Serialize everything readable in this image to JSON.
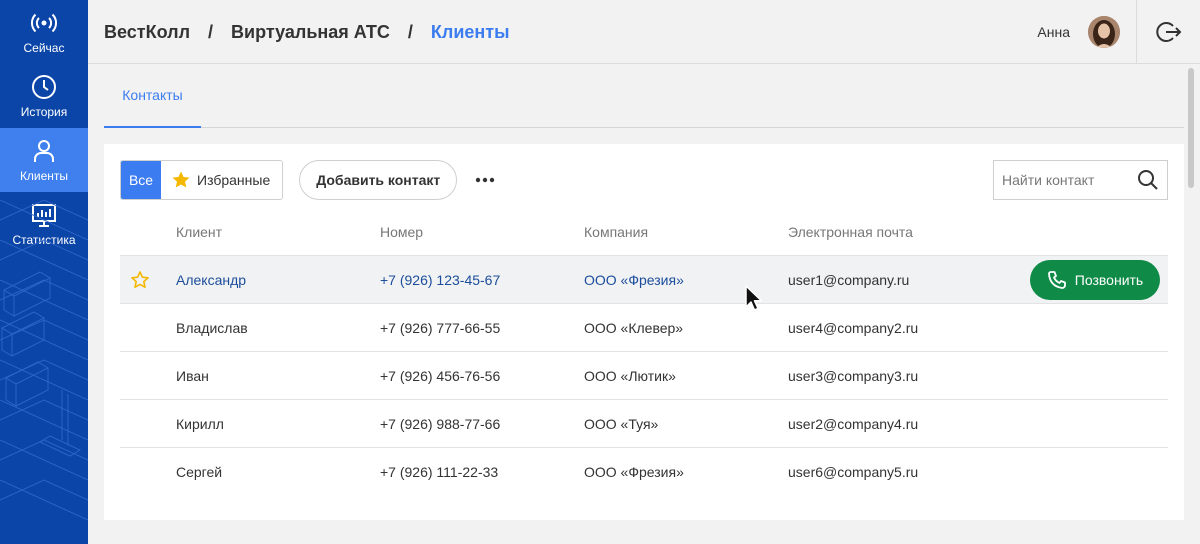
{
  "sidebar": {
    "items": [
      {
        "label": "Сейчас",
        "icon": "broadcast-icon"
      },
      {
        "label": "История",
        "icon": "clock-icon"
      },
      {
        "label": "Клиенты",
        "icon": "person-icon"
      },
      {
        "label": "Статистика",
        "icon": "chart-icon"
      }
    ],
    "active": "Клиенты"
  },
  "header": {
    "breadcrumb": [
      "ВестКолл",
      "Виртуальная АТС",
      "Клиенты"
    ],
    "separator": "/",
    "user_name": "Анна"
  },
  "tabs": [
    {
      "label": "Контакты"
    }
  ],
  "toolbar": {
    "filter_all": "Все",
    "filter_favorites": "Избранные",
    "add_contact": "Добавить контакт",
    "search_placeholder": "Найти контакт"
  },
  "table": {
    "columns": [
      "Клиент",
      "Номер",
      "Компания",
      "Электронная почта"
    ],
    "rows": [
      {
        "name": "Александр",
        "phone": "+7 (926) 123-45-67",
        "company": "ООО «Фрезия»",
        "email": "user1@company.ru"
      },
      {
        "name": "Владислав",
        "phone": "+7 (926) 777-66-55",
        "company": "ООО «Клевер»",
        "email": "user4@company2.ru"
      },
      {
        "name": "Иван",
        "phone": "+7 (926) 456-76-56",
        "company": "ООО «Лютик»",
        "email": "user3@company3.ru"
      },
      {
        "name": "Кирилл",
        "phone": "+7 (926) 988-77-66",
        "company": "ООО «Туя»",
        "email": "user2@company4.ru"
      },
      {
        "name": "Сергей",
        "phone": "+7 (926) 111-22-33",
        "company": "ООО «Фрезия»",
        "email": "user6@company5.ru"
      }
    ],
    "call_label": "Позвонить"
  },
  "colors": {
    "sidebar_bg": "#0b45a8",
    "active_nav": "#3f80ee",
    "accent": "#3b7cf0",
    "call_button": "#0f8a47",
    "star": "#f5b800"
  }
}
